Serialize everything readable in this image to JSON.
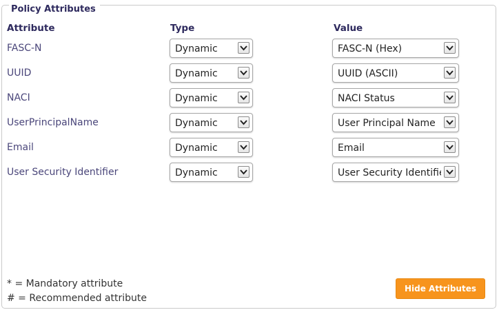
{
  "panel": {
    "legend": "Policy Attributes"
  },
  "table": {
    "headers": {
      "attribute": "Attribute",
      "type": "Type",
      "value": "Value"
    },
    "rows": [
      {
        "attribute": "FASC-N",
        "type": "Dynamic",
        "value": "FASC-N (Hex)"
      },
      {
        "attribute": "UUID",
        "type": "Dynamic",
        "value": "UUID (ASCII)"
      },
      {
        "attribute": "NACI",
        "type": "Dynamic",
        "value": "NACI Status"
      },
      {
        "attribute": "UserPrincipalName",
        "type": "Dynamic",
        "value": "User Principal Name"
      },
      {
        "attribute": "Email",
        "type": "Dynamic",
        "value": "Email"
      },
      {
        "attribute": "User Security Identifier",
        "type": "Dynamic",
        "value": "User Security Identifier"
      }
    ]
  },
  "footer": {
    "mandatory_note": "* = Mandatory attribute",
    "recommended_note": "# = Recommended attribute",
    "hide_button": "Hide Attributes"
  },
  "colors": {
    "accent": "#f7941d",
    "label_text": "#2e2a5e"
  },
  "icons": {
    "dropdown": "chevron-down-icon"
  }
}
